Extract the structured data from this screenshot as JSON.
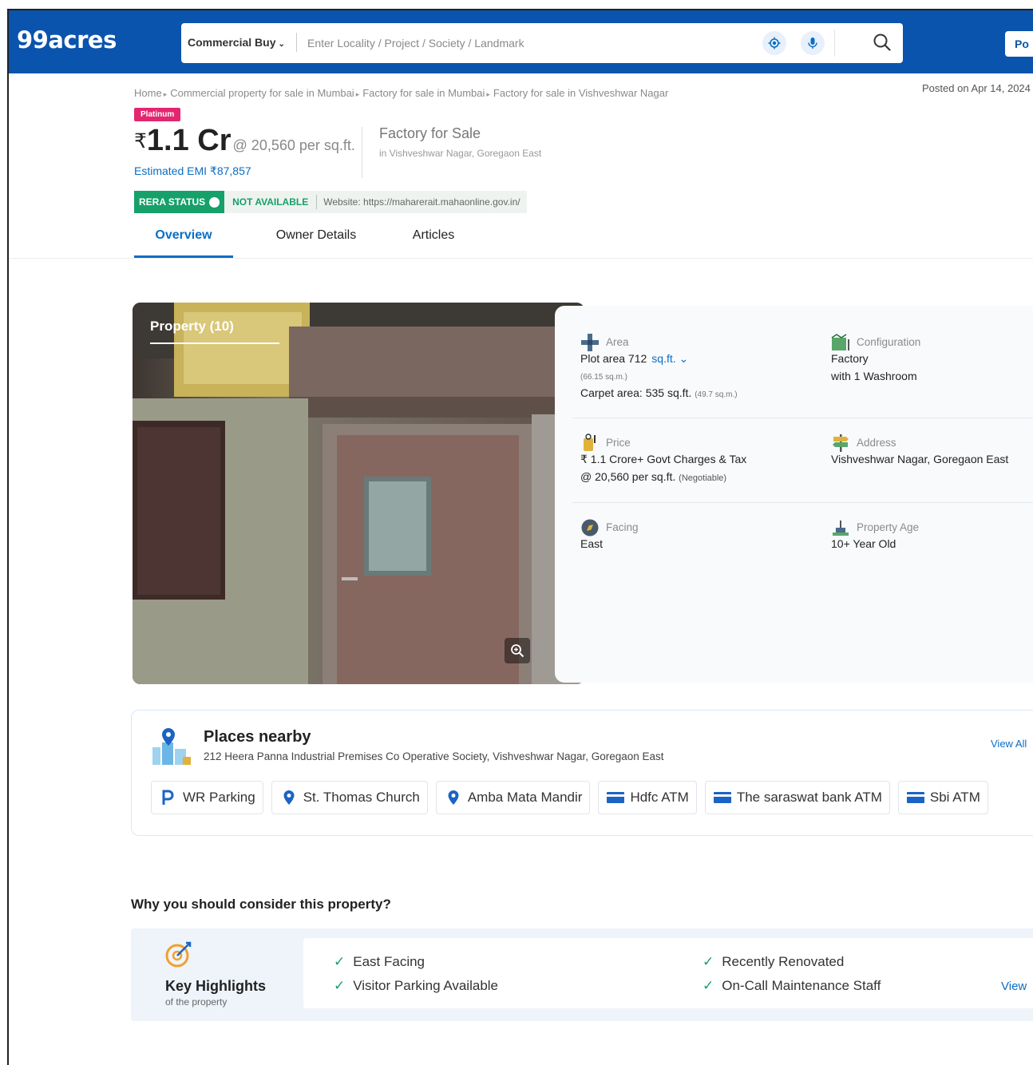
{
  "brand": {
    "logo": "99acres"
  },
  "search": {
    "type_label": "Commercial Buy",
    "placeholder": "Enter Locality / Project / Society / Landmark",
    "post_button": "Po"
  },
  "breadcrumb": [
    "Home",
    "Commercial property for sale in Mumbai",
    "Factory for sale in Mumbai",
    "Factory for sale in Vishveshwar Nagar"
  ],
  "posted": "Posted on Apr 14, 2024",
  "listing": {
    "badge": "Platinum",
    "currency": "₹",
    "price": "1.1 Cr",
    "price_per": "@ 20,560 per sq.ft.",
    "emi": "Estimated EMI ₹87,857",
    "type": "Factory for Sale",
    "location": "in Vishveshwar Nagar, Goregaon East"
  },
  "rera": {
    "status_label": "RERA STATUS",
    "value": "NOT AVAILABLE",
    "website": "Website: https://maharerait.mahaonline.gov.in/"
  },
  "tabs": [
    {
      "label": "Overview",
      "active": true
    },
    {
      "label": "Owner Details",
      "active": false
    },
    {
      "label": "Articles",
      "active": false
    }
  ],
  "gallery": {
    "label": "Property (10)"
  },
  "details": {
    "area": {
      "label": "Area",
      "plot": "Plot area 712",
      "unit": "sq.ft.",
      "plot_sqm": "(66.15 sq.m.)",
      "carpet": "Carpet area: 535 sq.ft.",
      "carpet_sqm": "(49.7 sq.m.)"
    },
    "configuration": {
      "label": "Configuration",
      "line1": "Factory",
      "line2": "with 1 Washroom"
    },
    "price": {
      "label": "Price",
      "line1": "₹ 1.1 Crore+ Govt Charges & Tax",
      "line2": "@ 20,560 per sq.ft.",
      "note": "(Negotiable)"
    },
    "address": {
      "label": "Address",
      "line1": "Vishveshwar Nagar, Goregaon East"
    },
    "facing": {
      "label": "Facing",
      "value": "East"
    },
    "age": {
      "label": "Property Age",
      "value": "10+ Year Old"
    }
  },
  "places": {
    "title": "Places nearby",
    "address": "212 Heera Panna Industrial Premises Co Operative Society, Vishveshwar Nagar, Goregaon East",
    "view_all": "View All",
    "chips": [
      {
        "icon": "parking-icon",
        "label": "WR Parking"
      },
      {
        "icon": "location-pin-icon",
        "label": "St. Thomas Church"
      },
      {
        "icon": "location-pin-icon",
        "label": "Amba Mata Mandir"
      },
      {
        "icon": "atm-card-icon",
        "label": "Hdfc ATM"
      },
      {
        "icon": "atm-card-icon",
        "label": "The saraswat bank ATM"
      },
      {
        "icon": "atm-card-icon",
        "label": "Sbi ATM"
      }
    ]
  },
  "why": {
    "title": "Why you should consider this property?",
    "box_title": "Key Highlights",
    "box_sub": "of the property",
    "items": [
      "East Facing",
      "Recently Renovated",
      "Visitor Parking Available",
      "On-Call Maintenance Staff"
    ],
    "view": "View"
  },
  "colors": {
    "brand_blue": "#0a54ad",
    "link_blue": "#0a6ec4",
    "platinum_pink": "#e3266f",
    "rera_green": "#16a06a"
  }
}
